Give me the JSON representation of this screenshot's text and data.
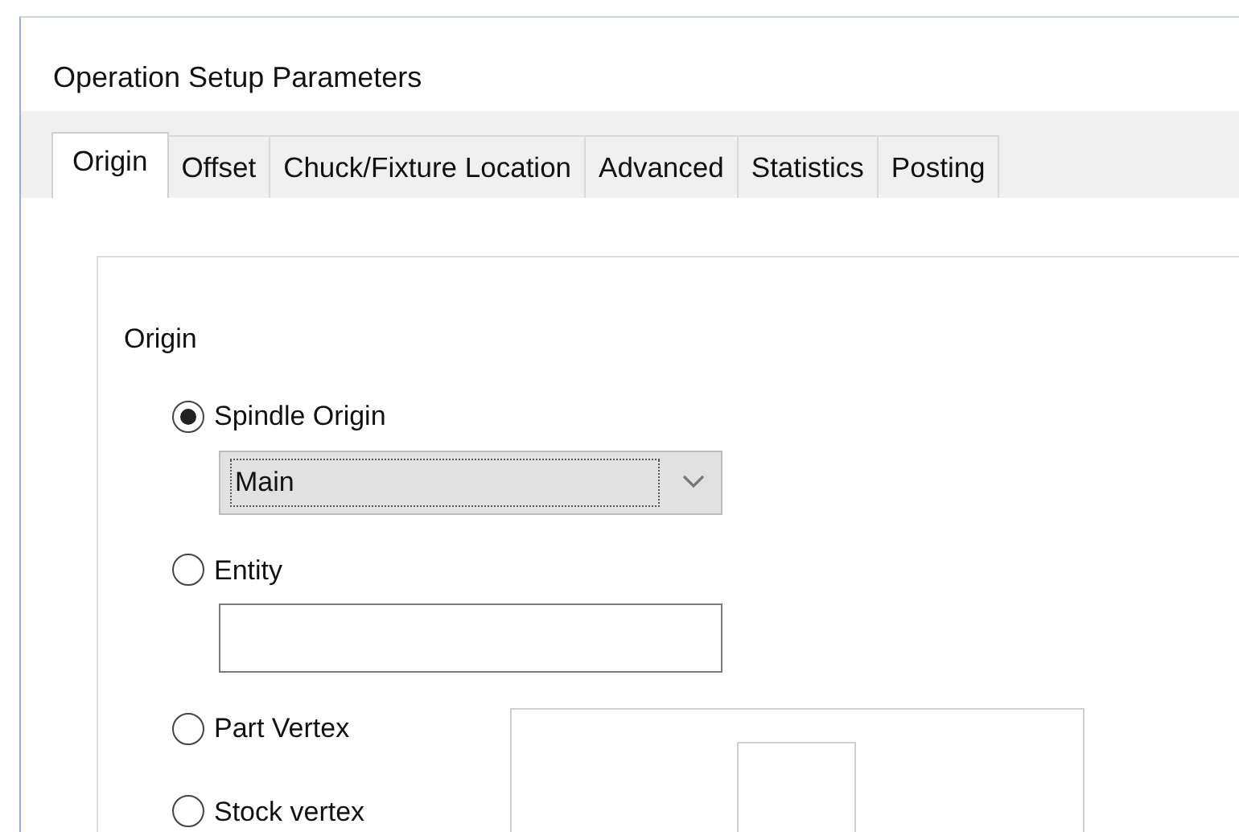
{
  "window": {
    "title": "Operation Setup Parameters"
  },
  "tabs": [
    {
      "label": "Origin",
      "selected": true
    },
    {
      "label": "Offset",
      "selected": false
    },
    {
      "label": "Chuck/Fixture Location",
      "selected": false
    },
    {
      "label": "Advanced",
      "selected": false
    },
    {
      "label": "Statistics",
      "selected": false
    },
    {
      "label": "Posting",
      "selected": false
    }
  ],
  "origin_group": {
    "title": "Origin",
    "options": [
      {
        "label": "Spindle Origin",
        "selected": true,
        "control": {
          "kind": "dropdown",
          "value": "Main"
        }
      },
      {
        "label": "Entity",
        "selected": false,
        "control": {
          "kind": "text"
        }
      },
      {
        "label": "Part Vertex",
        "selected": false
      },
      {
        "label": "Stock vertex",
        "selected": false
      }
    ]
  }
}
